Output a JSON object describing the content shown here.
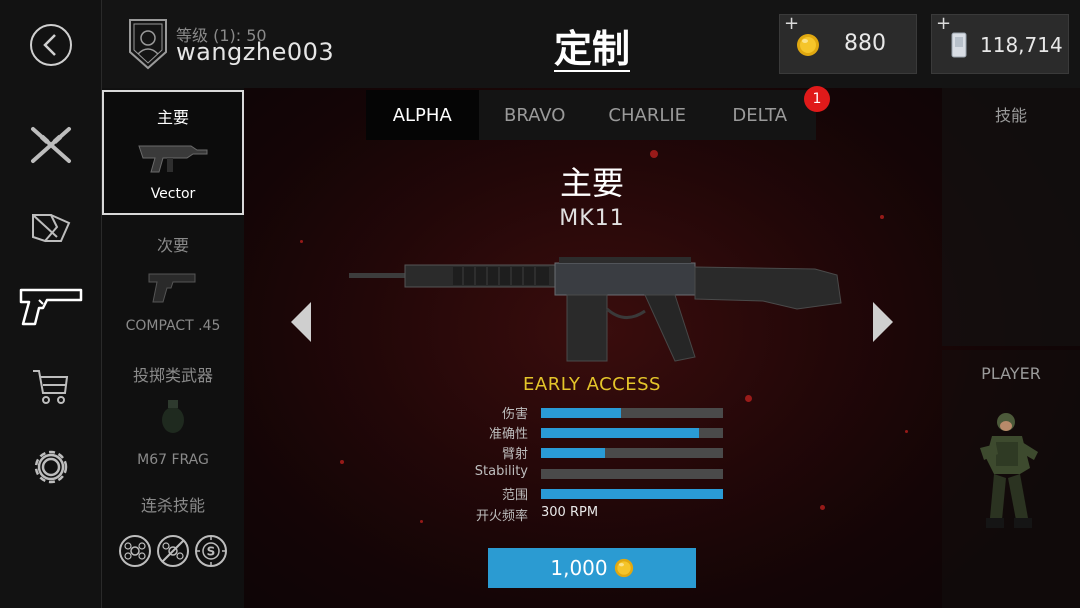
{
  "header": {
    "rank_label": "等级 (1): 50",
    "username": "wangzhe003",
    "page_title": "定制"
  },
  "currency": [
    {
      "plus": "+",
      "amount": "880",
      "icon": "gold-coin-icon"
    },
    {
      "plus": "+",
      "amount": "118,714",
      "icon": "silver-card-icon"
    }
  ],
  "rail": [
    {
      "icon": "back-arrow-icon"
    },
    {
      "icon": "crossed-rifles-icon"
    },
    {
      "icon": "target-shards-icon"
    },
    {
      "icon": "pistol-icon"
    },
    {
      "icon": "shopping-cart-icon"
    },
    {
      "icon": "gear-icon"
    }
  ],
  "loadout": {
    "slots": [
      {
        "category": "主要",
        "weapon": "Vector"
      },
      {
        "category": "次要",
        "weapon": "COMPACT .45"
      },
      {
        "category": "投掷类武器",
        "weapon": "M67 FRAG"
      },
      {
        "category": "连杀技能",
        "weapon": ""
      }
    ]
  },
  "tabs": [
    "ALPHA",
    "BRAVO",
    "CHARLIE",
    "DELTA"
  ],
  "tab_badge": "1",
  "weapon": {
    "slot_title": "主要",
    "name": "MK11",
    "early_access": "EARLY ACCESS",
    "price": "1,000"
  },
  "stats": [
    {
      "label": "伤害",
      "value": 0.44
    },
    {
      "label": "准确性",
      "value": 0.87
    },
    {
      "label": "臂射",
      "value": 0.35
    },
    {
      "label": "Stability",
      "value": 0.0
    },
    {
      "label": "范围",
      "value": 1.0
    },
    {
      "label": "开火频率",
      "text": "300 RPM"
    }
  ],
  "right": {
    "skills_label": "技能",
    "player_label": "PLAYER"
  },
  "colors": {
    "accent_blue": "#2a9bd6",
    "early_access_yellow": "#e4c52a",
    "badge_red": "#e01a1a"
  }
}
